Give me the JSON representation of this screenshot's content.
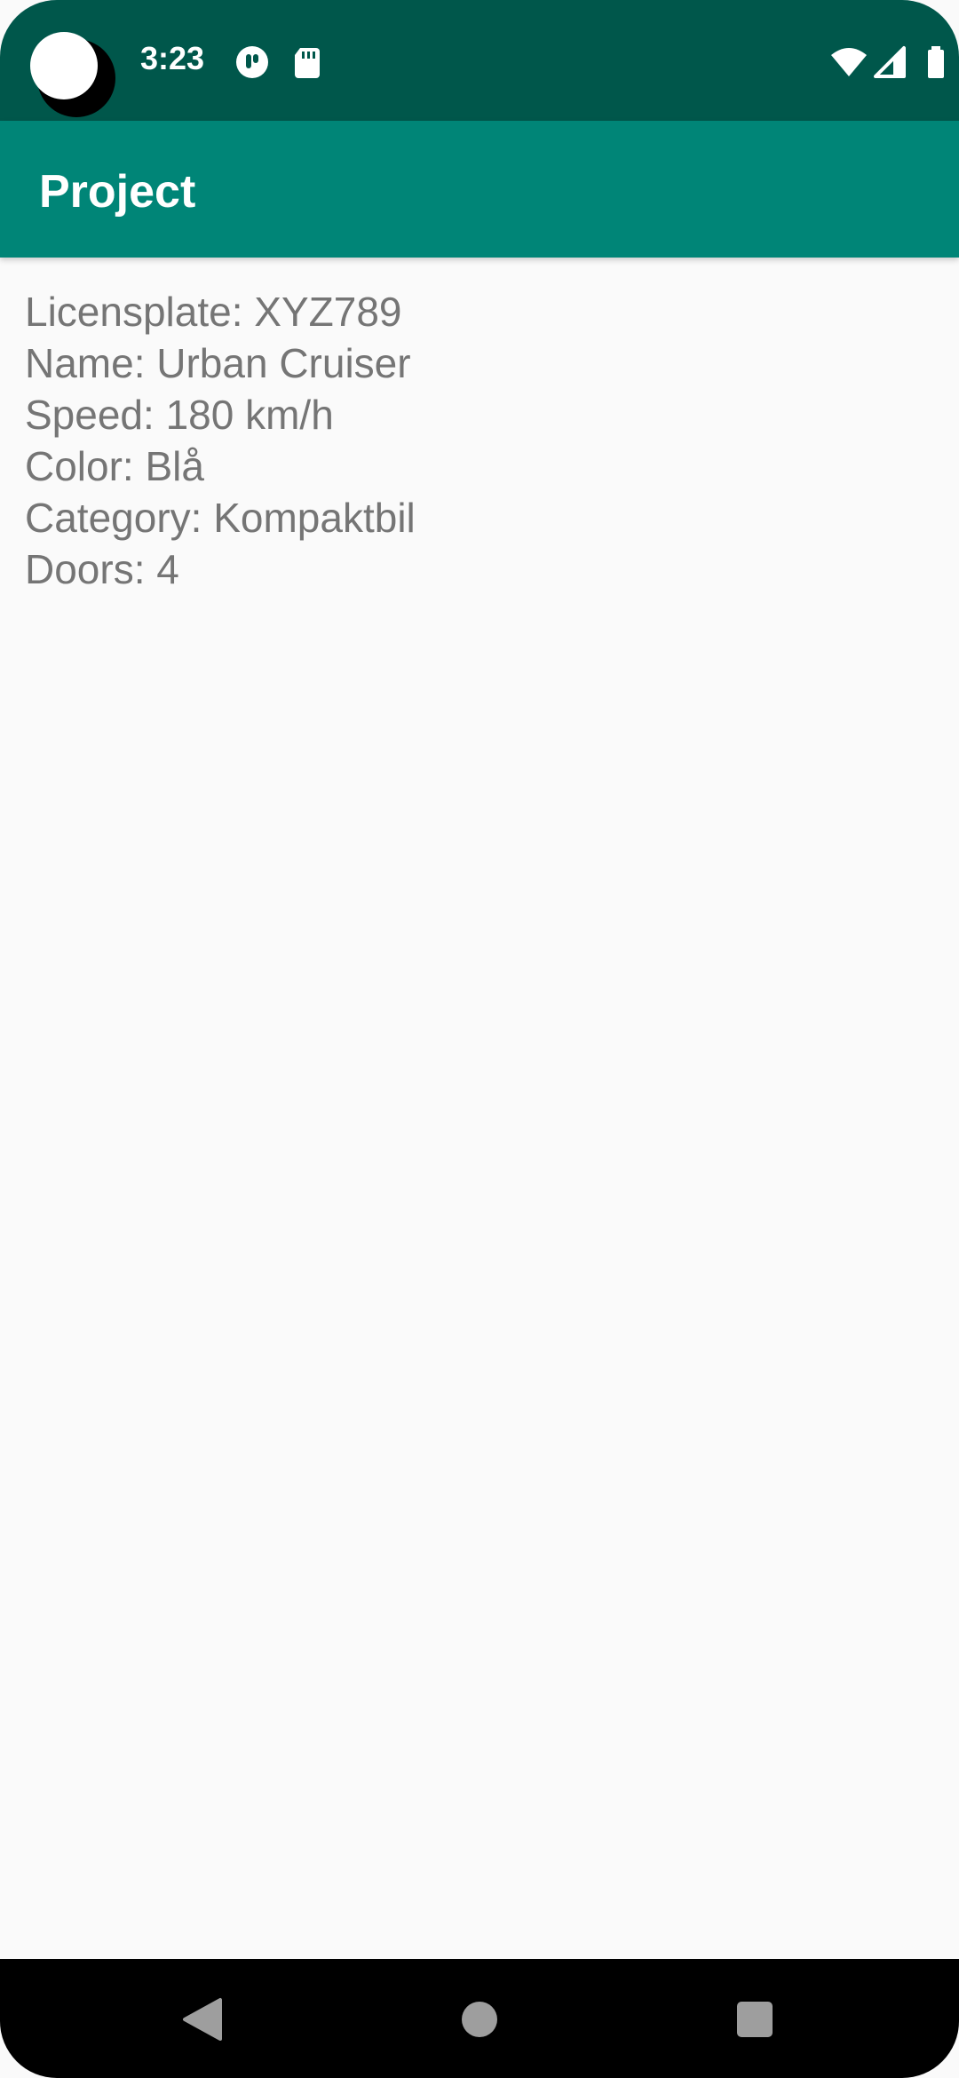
{
  "status_bar": {
    "time": "3:23",
    "icons": [
      "notification-app-icon",
      "sd-card-icon",
      "wifi-icon",
      "signal-icon",
      "battery-icon"
    ]
  },
  "app_bar": {
    "title": "Project"
  },
  "details": [
    "Licensplate: XYZ789",
    "Name: Urban Cruiser",
    "Speed: 180 km/h",
    "Color: Blå",
    "Category: Kompaktbil",
    "Doors: 4"
  ],
  "nav_bar": {
    "buttons": [
      "back-icon",
      "home-icon",
      "recents-icon"
    ]
  },
  "colors": {
    "status_bar": "#00574b",
    "app_bar": "#008577",
    "text": "#757575",
    "background": "#fafafa"
  }
}
